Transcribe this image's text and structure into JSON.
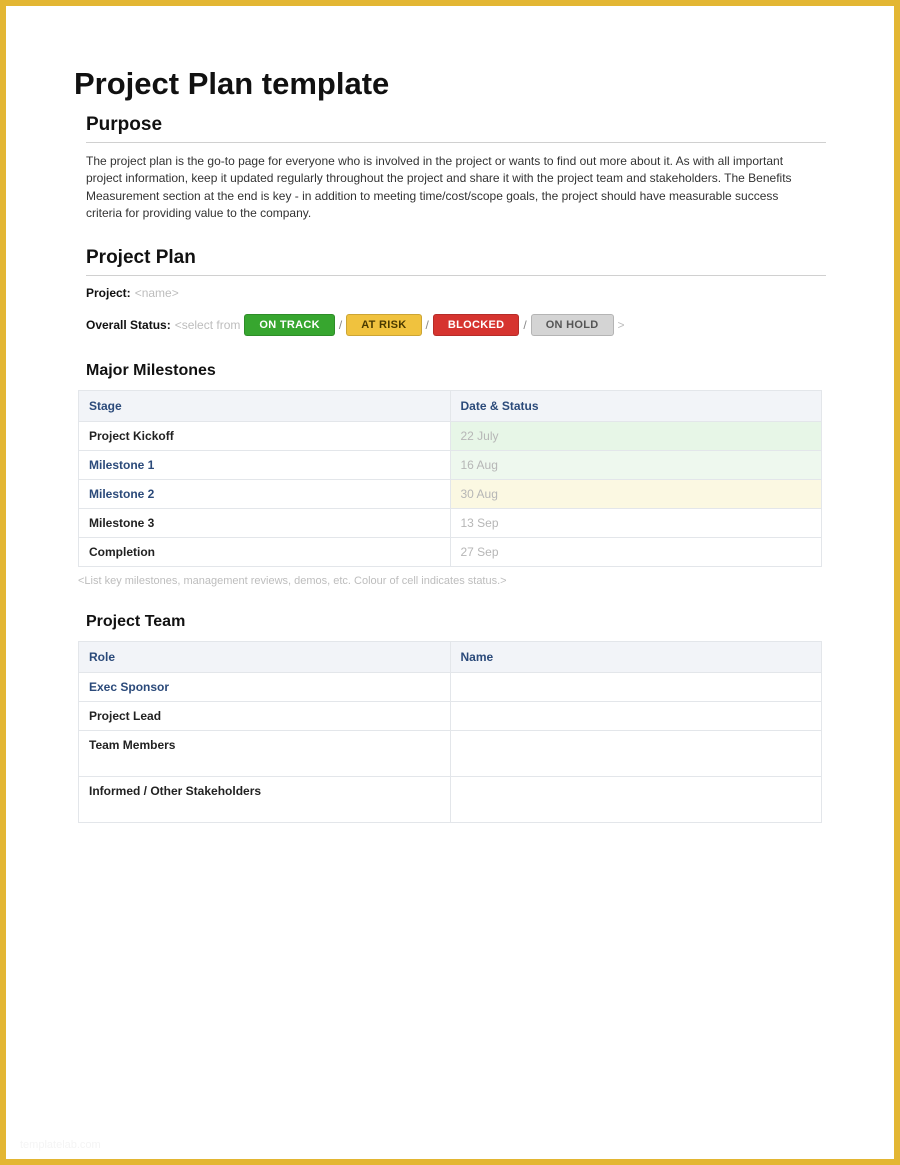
{
  "title": "Project Plan template",
  "purpose": {
    "heading": "Purpose",
    "body": "The project plan is the go-to page for everyone who is involved in the project or wants to find out more about it.  As with all important project information, keep it updated regularly throughout the project and share it with the project team and stakeholders.  The Benefits Measurement section at the end is key - in addition to meeting time/cost/scope goals, the project should have measurable success criteria for providing value to the company."
  },
  "plan": {
    "heading": "Project Plan",
    "project_label": "Project:",
    "project_value": "<name>",
    "status_label": "Overall Status:",
    "status_prefix": "<select from",
    "status_suffix": ">",
    "statuses": [
      "ON TRACK",
      "AT RISK",
      "BLOCKED",
      "ON HOLD"
    ]
  },
  "milestones": {
    "heading": "Major Milestones",
    "col_stage": "Stage",
    "col_date": "Date & Status",
    "rows": [
      {
        "stage": "Project Kickoff",
        "date": "22 July",
        "link": false,
        "tint": "green"
      },
      {
        "stage": "Milestone 1",
        "date": "16 Aug",
        "link": true,
        "tint": "green2"
      },
      {
        "stage": "Milestone 2",
        "date": "30 Aug",
        "link": true,
        "tint": "yellow"
      },
      {
        "stage": "Milestone 3",
        "date": "13 Sep",
        "link": false,
        "tint": ""
      },
      {
        "stage": "Completion",
        "date": "27 Sep",
        "link": false,
        "tint": ""
      }
    ],
    "footnote": "<List key milestones, management reviews, demos, etc.  Colour of cell indicates status.>"
  },
  "team": {
    "heading": "Project Team",
    "col_role": "Role",
    "col_name": "Name",
    "rows": [
      {
        "role": "Exec Sponsor",
        "link": true,
        "tall": false
      },
      {
        "role": "Project Lead",
        "link": false,
        "tall": false
      },
      {
        "role": "Team Members",
        "link": false,
        "tall": true
      },
      {
        "role": "Informed / Other Stakeholders",
        "link": false,
        "tall": true
      }
    ]
  },
  "watermark": "templatelab.com"
}
